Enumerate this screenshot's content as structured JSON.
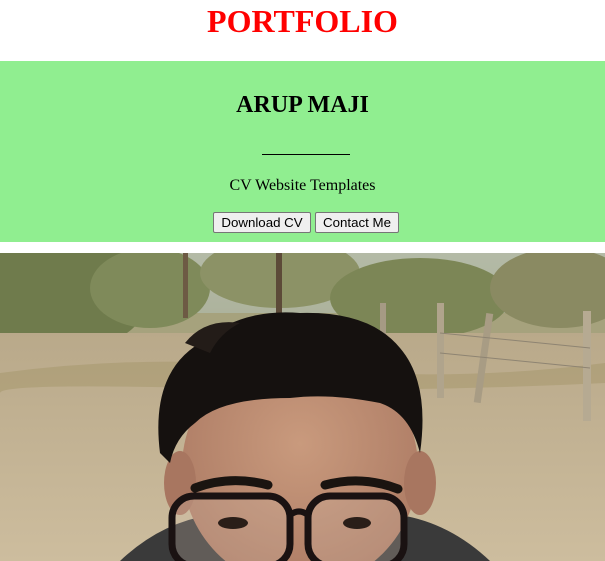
{
  "header": {
    "title": "PORTFOLIO",
    "title_color": "#ff0000"
  },
  "hero": {
    "background_color": "#90ee90",
    "name": "ARUP MAJI",
    "subtitle": "CV Website Templates",
    "buttons": {
      "download_label": "Download CV",
      "contact_label": "Contact Me"
    }
  },
  "photo": {
    "subject": "profile-photo"
  }
}
